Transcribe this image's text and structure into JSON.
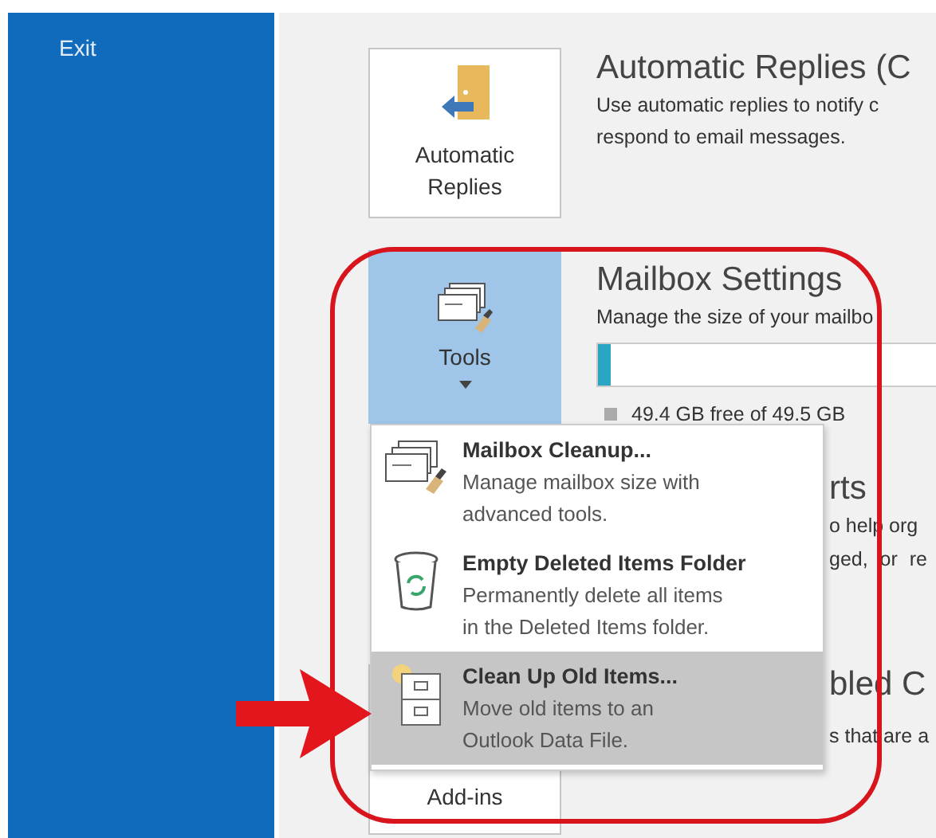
{
  "sidebar": {
    "items": [
      {
        "label": "Exit"
      }
    ]
  },
  "automatic_replies": {
    "button": "Automatic Replies",
    "title": "Automatic Replies (C",
    "description": [
      "Use automatic replies to notify c",
      "respond to email messages."
    ]
  },
  "mailbox_settings": {
    "button": "Tools",
    "title": "Mailbox Settings",
    "description": "Manage the size of your mailbo",
    "storage": {
      "level": 0.03,
      "legend": "49.4 GB free of 49.5 GB"
    }
  },
  "section_3": {
    "title": "rts",
    "description": [
      "o help org",
      "ged, or re"
    ]
  },
  "section_4": {
    "button": "Add-ins",
    "title": "bled C",
    "description": "s that are a"
  },
  "tools_menu": [
    {
      "kind": "cleanup",
      "title": "Mailbox Cleanup...",
      "description": [
        "Manage mailbox size with",
        "advanced tools."
      ],
      "selected": false
    },
    {
      "kind": "trash",
      "title": "Empty Deleted Items Folder",
      "description": [
        "Permanently delete all items",
        "in the Deleted Items folder."
      ],
      "selected": false
    },
    {
      "kind": "archive",
      "title": "Clean Up Old Items...",
      "description": [
        "Move old items to an",
        "Outlook Data File."
      ],
      "selected": true
    }
  ]
}
